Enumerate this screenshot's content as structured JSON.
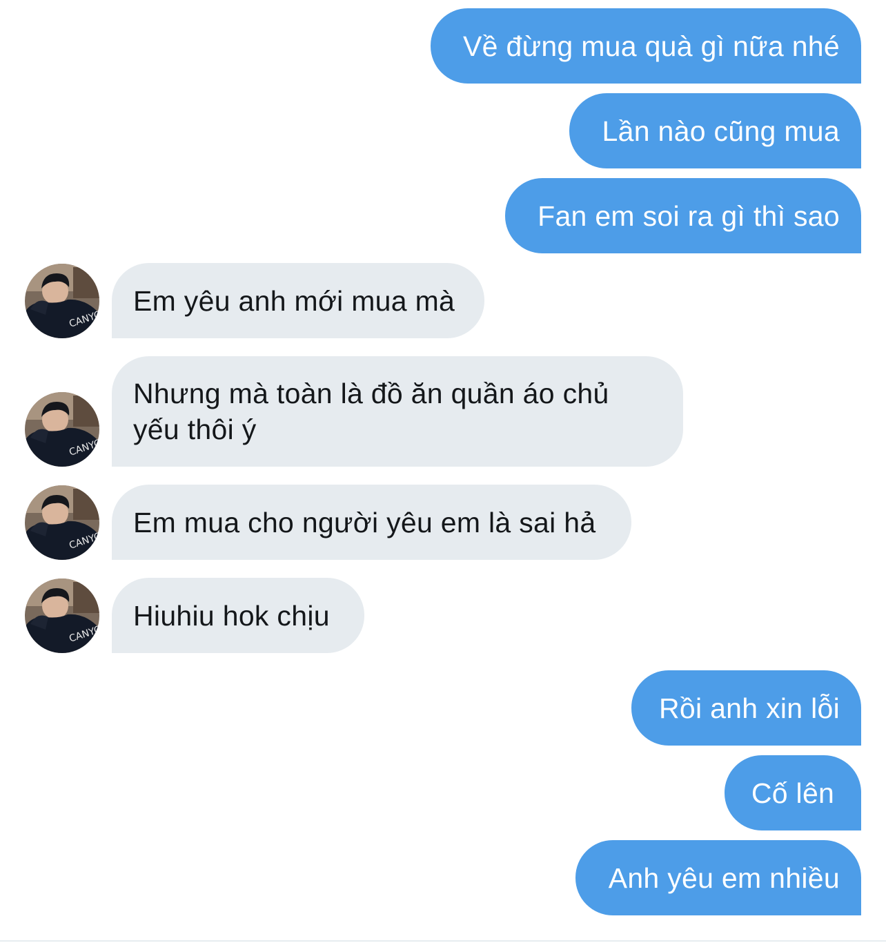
{
  "conversation": {
    "messages": [
      {
        "sender": "me",
        "text": "Về đừng mua quà gì nữa nhé"
      },
      {
        "sender": "me",
        "text": "Lần nào cũng mua"
      },
      {
        "sender": "me",
        "text": "Fan em soi ra gì thì sao"
      },
      {
        "sender": "other",
        "text": "Em yêu anh mới mua mà"
      },
      {
        "sender": "other",
        "text": "Nhưng mà toàn là đồ ăn quần áo chủ yếu thôi ý"
      },
      {
        "sender": "other",
        "text": "Em mua cho người yêu em là sai hả"
      },
      {
        "sender": "other",
        "text": "Hiuhiu hok chịu"
      },
      {
        "sender": "me",
        "text": "Rồi anh xin lỗi"
      },
      {
        "sender": "me",
        "text": "Cố lên"
      },
      {
        "sender": "me",
        "text": "Anh yêu em nhiều"
      }
    ],
    "avatar_jacket_text": "CANYON"
  },
  "colors": {
    "sent_bubble": "#4d9de8",
    "received_bubble": "#e6ebef",
    "sent_text": "#ffffff",
    "received_text": "#14171a"
  }
}
